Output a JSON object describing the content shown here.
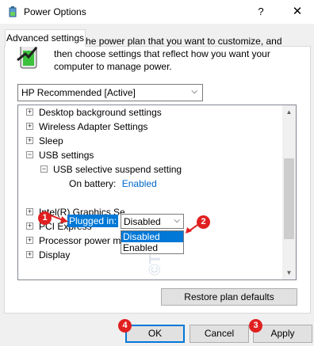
{
  "window": {
    "title": "Power Options",
    "help_glyph": "?",
    "close_glyph": "✕"
  },
  "tab": {
    "label": "Advanced settings"
  },
  "description": "Select the power plan that you want to customize, and then choose settings that reflect how you want your computer to manage power.",
  "plan_select": {
    "value": "HP Recommended [Active]"
  },
  "tree": {
    "items": [
      {
        "label": "Desktop background settings",
        "expander": "+"
      },
      {
        "label": "Wireless Adapter Settings",
        "expander": "+"
      },
      {
        "label": "Sleep",
        "expander": "+"
      },
      {
        "label": "USB settings",
        "expander": "−"
      },
      {
        "label": "USB selective suspend setting",
        "expander": "−"
      },
      {
        "label": "On battery:",
        "value": "Enabled"
      },
      {
        "label": "Plugged in:",
        "value": "Disabled"
      },
      {
        "label": "Intel(R) Graphics Se",
        "expander": "+"
      },
      {
        "label": "PCI Express",
        "expander": "+"
      },
      {
        "label": "Processor power management",
        "expander": "+"
      },
      {
        "label": "Display",
        "expander": "+"
      }
    ]
  },
  "dropdown": {
    "options": [
      "Disabled",
      "Enabled"
    ],
    "selected": "Disabled"
  },
  "buttons": {
    "restore": "Restore plan defaults",
    "ok": "OK",
    "cancel": "Cancel",
    "apply": "Apply"
  },
  "badges": [
    "1",
    "2",
    "3",
    "4"
  ],
  "watermark": "©TGP",
  "colors": {
    "selection": "#0078d7",
    "link": "#0066cc",
    "badge": "#e02020"
  }
}
